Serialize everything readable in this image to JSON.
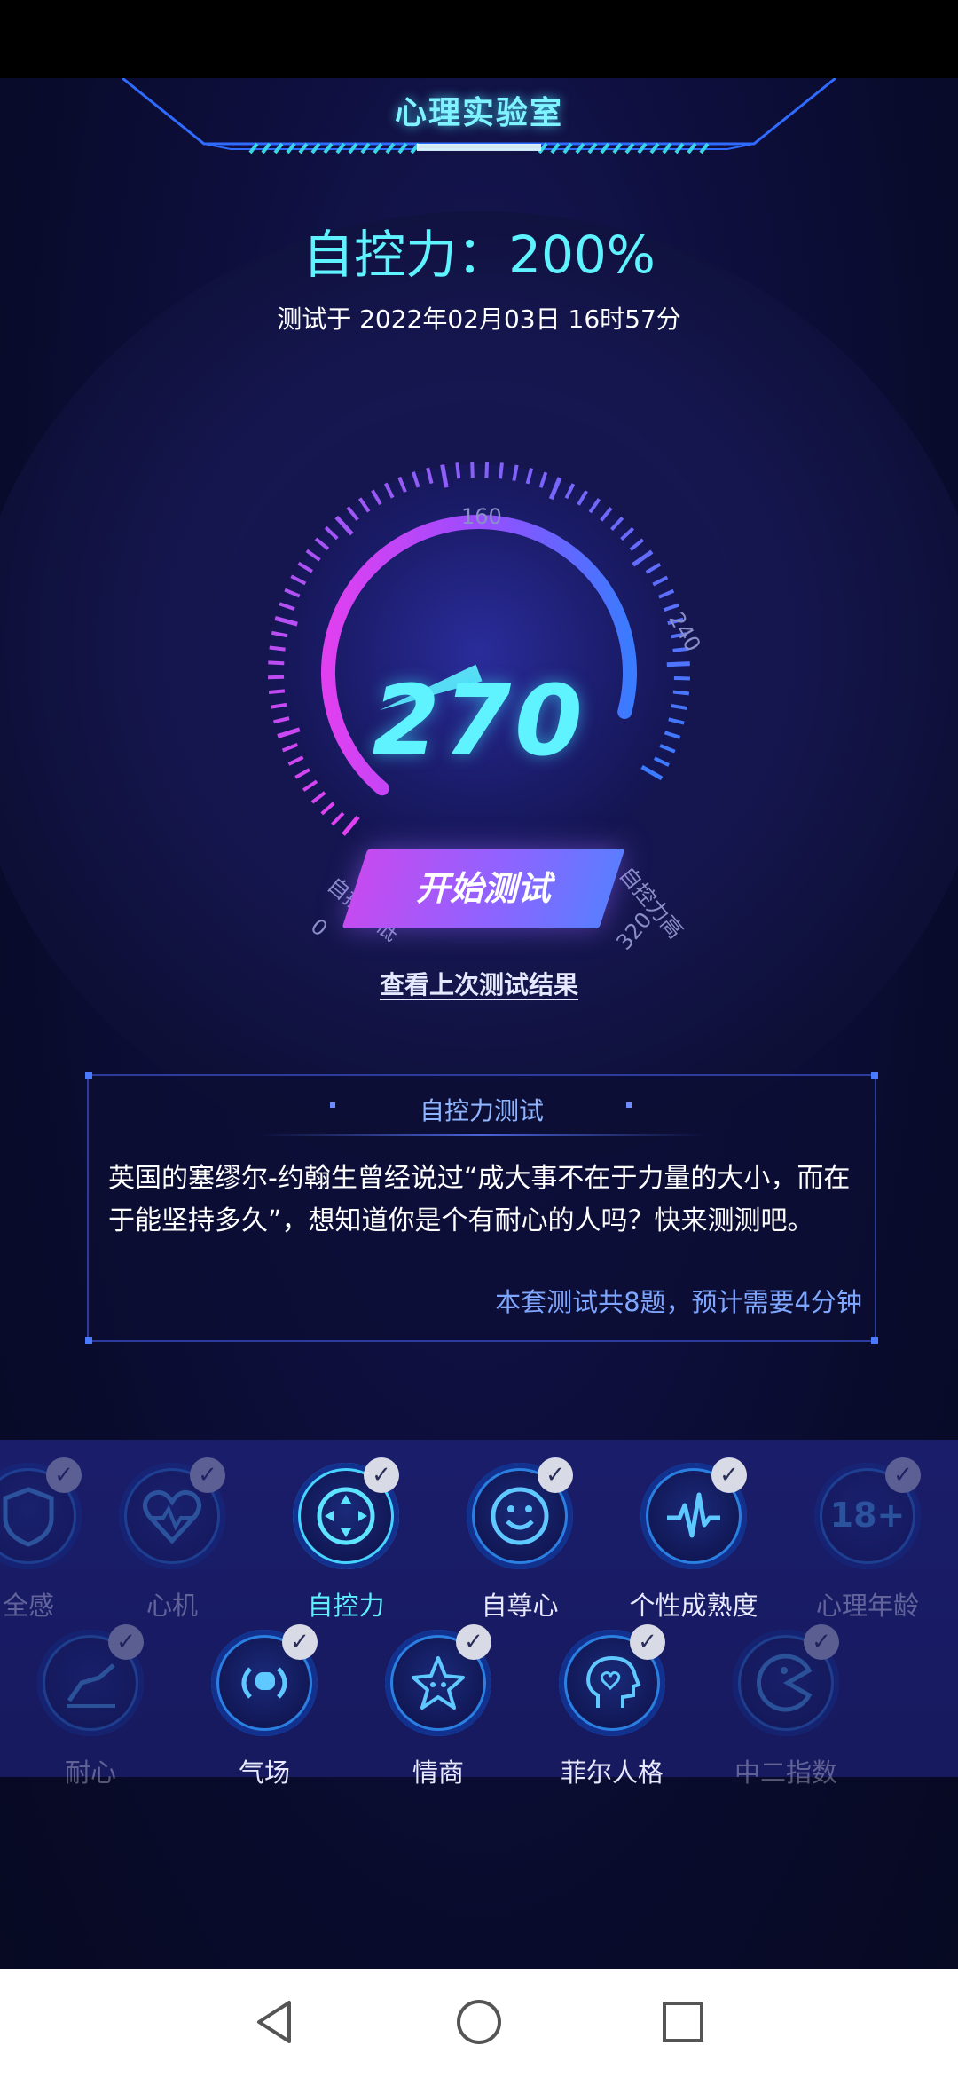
{
  "header": {
    "title": "心理实验室"
  },
  "result": {
    "title": "自控力：200%",
    "time": "测试于 2022年02月03日 16时57分"
  },
  "gauge": {
    "value": "270",
    "tick_labels": [
      "0",
      "160",
      "240",
      "320"
    ],
    "low_label": "自控力低",
    "high_label": "自控力高"
  },
  "actions": {
    "start_label": "开始测试",
    "last_result_link": "查看上次测试结果"
  },
  "info": {
    "title": "自控力测试",
    "description": "英国的塞缪尔-约翰生曾经说过“成大事不在于力量的大小，而在于能坚持多久”，想知道你是个有耐心的人吗？快来测测吧。",
    "footer": "本套测试共8题，预计需要4分钟"
  },
  "categories": {
    "row1": [
      {
        "label": "全感",
        "icon": "shield-icon",
        "checked": true
      },
      {
        "label": "心机",
        "icon": "heart-pulse-icon",
        "checked": true
      },
      {
        "label": "自控力",
        "icon": "dpad-icon",
        "checked": true,
        "active": true
      },
      {
        "label": "自尊心",
        "icon": "smile-icon",
        "checked": true
      },
      {
        "label": "个性成熟度",
        "icon": "waveform-icon",
        "checked": true
      },
      {
        "label": "心理年龄",
        "icon": "age-18-icon",
        "checked": true
      }
    ],
    "row2": [
      {
        "label": "耐心",
        "icon": "trend-icon",
        "checked": true
      },
      {
        "label": "气场",
        "icon": "broadcast-icon",
        "checked": true
      },
      {
        "label": "情商",
        "icon": "star-face-icon",
        "checked": true
      },
      {
        "label": "菲尔人格",
        "icon": "head-heart-icon",
        "checked": true
      },
      {
        "label": "中二指数",
        "icon": "pacman-icon",
        "checked": true
      }
    ],
    "check_glyph": "✓",
    "age_text": "18+"
  },
  "colors": {
    "accent_cyan": "#5ff2ff",
    "gauge_start": "#e040f0",
    "gauge_end": "#3a7bff",
    "info_border": "#2b3c9c"
  }
}
